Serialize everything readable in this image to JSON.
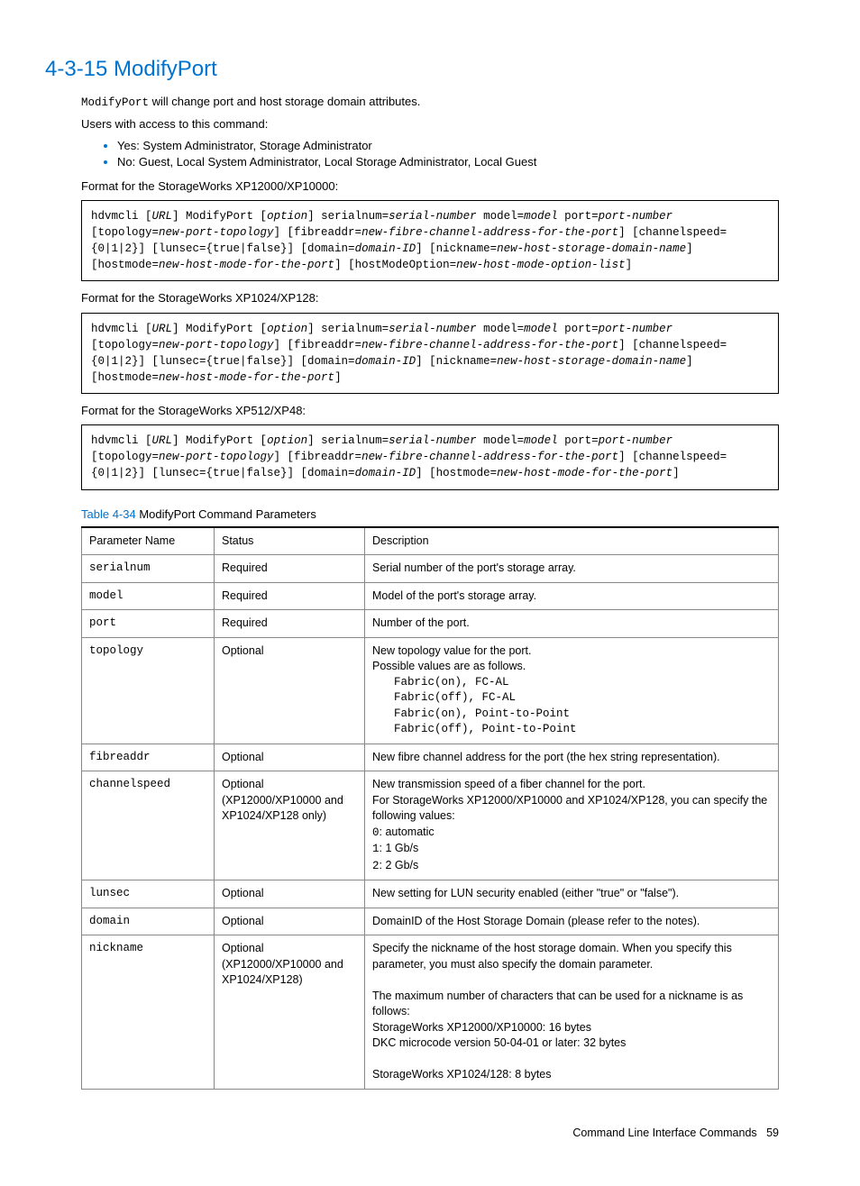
{
  "heading": "4-3-15 ModifyPort",
  "intro_cmd": "ModifyPort",
  "intro_rest": " will change port and host storage domain attributes.",
  "access_label": "Users with access to this command:",
  "access_yes": "Yes: System Administrator, Storage Administrator",
  "access_no": "No: Guest, Local System Administrator, Local Storage Administrator, Local Guest",
  "fmt1_label": "Format for the StorageWorks XP12000/XP10000:",
  "fmt2_label": "Format for the StorageWorks XP1024/XP128:",
  "fmt3_label": "Format for the StorageWorks XP512/XP48:",
  "code1": {
    "t1": "hdvmcli [",
    "i1": "URL",
    "t2": "] ModifyPort [",
    "i2": "option",
    "t3": "] serialnum=",
    "i3": "serial-number",
    "t4": " model=",
    "i4": "model",
    "t5": " port=",
    "i5": "port-number",
    "t6": " [topology=",
    "i6": "new-port-topology",
    "t7": "] [fibreaddr=",
    "i7": "new-fibre-channel-address-for-the-port",
    "t8": "] [channelspeed={0|1|2}] [lunsec={true|false}] [domain=",
    "i8": "domain-ID",
    "t9": "] [nickname=",
    "i9": "new-host-storage-domain-name",
    "t10": "] [hostmode=",
    "i10": "new-host-mode-for-the-port",
    "t11": "] [hostModeOption=",
    "i11": "new-host-mode-option-list",
    "t12": "]"
  },
  "code2": {
    "t1": "hdvmcli [",
    "i1": "URL",
    "t2": "] ModifyPort [",
    "i2": "option",
    "t3": "] serialnum=",
    "i3": "serial-number",
    "t4": " model=",
    "i4": "model",
    "t5": " port=",
    "i5": "port-number",
    "t6": " [topology=",
    "i6": "new-port-topology",
    "t7": "] [fibreaddr=",
    "i7": "new-fibre-channel-address-for-the-port",
    "t8": "] [channelspeed={0|1|2}] [lunsec={true|false}] [domain=",
    "i8": "domain-ID",
    "t9": "] [nickname=",
    "i9": "new-host-storage-domain-name",
    "t10": "] [hostmode=",
    "i10": "new-host-mode-for-the-port",
    "t11": "]"
  },
  "code3": {
    "t1": "hdvmcli [",
    "i1": "URL",
    "t2": "] ModifyPort [",
    "i2": "option",
    "t3": "] serialnum=",
    "i3": "serial-number",
    "t4": " model=",
    "i4": "model",
    "t5": " port=",
    "i5": "port-number",
    "t6": " [topology=",
    "i6": "new-port-topology",
    "t7": "] [fibreaddr=",
    "i7": "new-fibre-channel-address-for-the-port",
    "t8": "] [channelspeed={0|1|2}] [lunsec={true|false}] [domain=",
    "i8": "domain-ID",
    "t9": "] [hostmode=",
    "i9": "new-host-mode-for-the-port",
    "t10": "]"
  },
  "table_caption_label": "Table 4-34",
  "table_caption_text": "  ModifyPort Command Parameters",
  "th_param": "Parameter Name",
  "th_status": "Status",
  "th_desc": "Description",
  "rows": {
    "r0": {
      "p": "serialnum",
      "s": "Required",
      "d": "Serial number of the port's storage array."
    },
    "r1": {
      "p": "model",
      "s": "Required",
      "d": "Model of the port's storage array."
    },
    "r2": {
      "p": "port",
      "s": "Required",
      "d": "Number of the port."
    },
    "r3": {
      "p": "topology",
      "s": "Optional",
      "d_l1": "New topology value for the port.",
      "d_l2": "Possible values are as follows.",
      "d_c1": "Fabric(on), FC-AL",
      "d_c2": "Fabric(off), FC-AL",
      "d_c3": "Fabric(on), Point-to-Point",
      "d_c4": "Fabric(off), Point-to-Point"
    },
    "r4": {
      "p": "fibreaddr",
      "s": "Optional",
      "d": "New fibre channel address for the port (the hex string representation)."
    },
    "r5": {
      "p": "channelspeed",
      "s_l1": "Optional",
      "s_l2": "(XP12000/XP10000 and XP1024/XP128 only)",
      "d_l1": "New transmission speed of a fiber channel for the port.",
      "d_l2": "For StorageWorks XP12000/XP10000 and XP1024/XP128, you can specify the following values:",
      "d_c1": "0",
      "d_c1t": ": automatic",
      "d_c2": "1",
      "d_c2t": ": 1 Gb/s",
      "d_c3": "2",
      "d_c3t": ": 2 Gb/s"
    },
    "r6": {
      "p": "lunsec",
      "s": "Optional",
      "d": "New setting for LUN security enabled (either \"true\" or \"false\")."
    },
    "r7": {
      "p": "domain",
      "s": "Optional",
      "d": "DomainID of the Host Storage Domain (please refer to the notes)."
    },
    "r8": {
      "p": "nickname",
      "s_l1": "Optional",
      "s_l2": "(XP12000/XP10000 and XP1024/XP128)",
      "d_l1": "Specify the nickname of the host storage domain. When you specify this parameter, you must also specify the domain parameter.",
      "d_l2": "The maximum number of characters that can be used for a nickname is as follows:",
      "d_l3": "StorageWorks XP12000/XP10000: 16 bytes",
      "d_l4": "DKC microcode version 50-04-01 or later: 32 bytes",
      "d_l5": "StorageWorks XP1024/128: 8 bytes"
    }
  },
  "footer_text": "Command Line Interface Commands",
  "footer_page": "59"
}
